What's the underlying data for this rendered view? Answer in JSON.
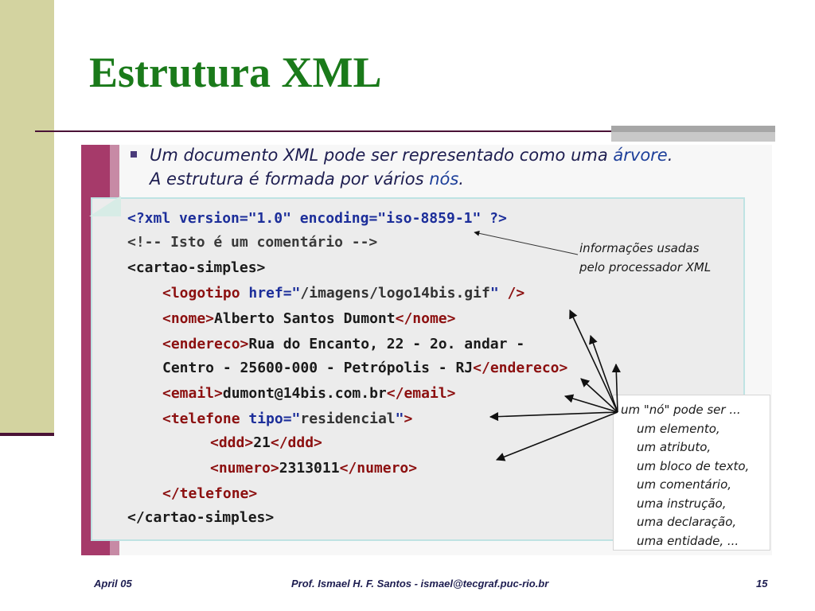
{
  "title": "Estrutura XML",
  "bullet": {
    "part1": "Um documento XML pode ser representado como uma ",
    "part2": "árvore",
    "part3": ". A estrutura é formada por vários ",
    "part4": "nós",
    "part5": "."
  },
  "code": {
    "l1_open": "<?xml ",
    "l1_attrs": "version=\"1.0\" encoding=\"iso-8859-1\" ?>",
    "l2": "<!-- Isto é um comentário -->",
    "l3": "<cartao-simples>",
    "l4_tag": "<logotipo ",
    "l4_attr": "href=\"",
    "l4_val": "/imagens/logo14bis.gif",
    "l4_q": "\"",
    "l4_end": " />",
    "l5_open": "<nome>",
    "l5_text": "Alberto Santos Dumont",
    "l5_close": "</nome>",
    "l6_open": "<endereco>",
    "l6_text": "Rua do Encanto, 22 - 2o. andar -",
    "l7_text": "Centro - 25600-000 - Petrópolis - RJ",
    "l7_close": "</endereco>",
    "l8_open": "<email>",
    "l8_text": "dumont@14bis.com.br",
    "l8_close": "</email>",
    "l9_tag": "<telefone ",
    "l9_attr": "tipo=\"",
    "l9_val": "residencial",
    "l9_q": "\"",
    "l9_end": ">",
    "l10_open": "<ddd>",
    "l10_text": "21",
    "l10_close": "</ddd>",
    "l11_open": "<numero>",
    "l11_text": "2313011",
    "l11_close": "</numero>",
    "l12": "</telefone>",
    "l13": "</cartao-simples>"
  },
  "note_processor": [
    "informações usadas",
    "pelo processador XML"
  ],
  "callout": {
    "heading": "um \"nó\" pode ser ...",
    "items": [
      "um elemento,",
      "um atributo,",
      "um bloco de texto,",
      "um comentário,",
      "uma instrução,",
      "uma declaração,",
      "uma entidade, ..."
    ]
  },
  "footer": {
    "date": "April 05",
    "author": "Prof. Ismael H. F. Santos -  ismael@tecgraf.puc-rio.br",
    "page": "15"
  },
  "colors": {
    "title": "#1a7a1a",
    "side_band": "#d3d3a0",
    "stripe": "#a63a6a",
    "tag": "#8c1010",
    "attr": "#1c2e9a"
  }
}
